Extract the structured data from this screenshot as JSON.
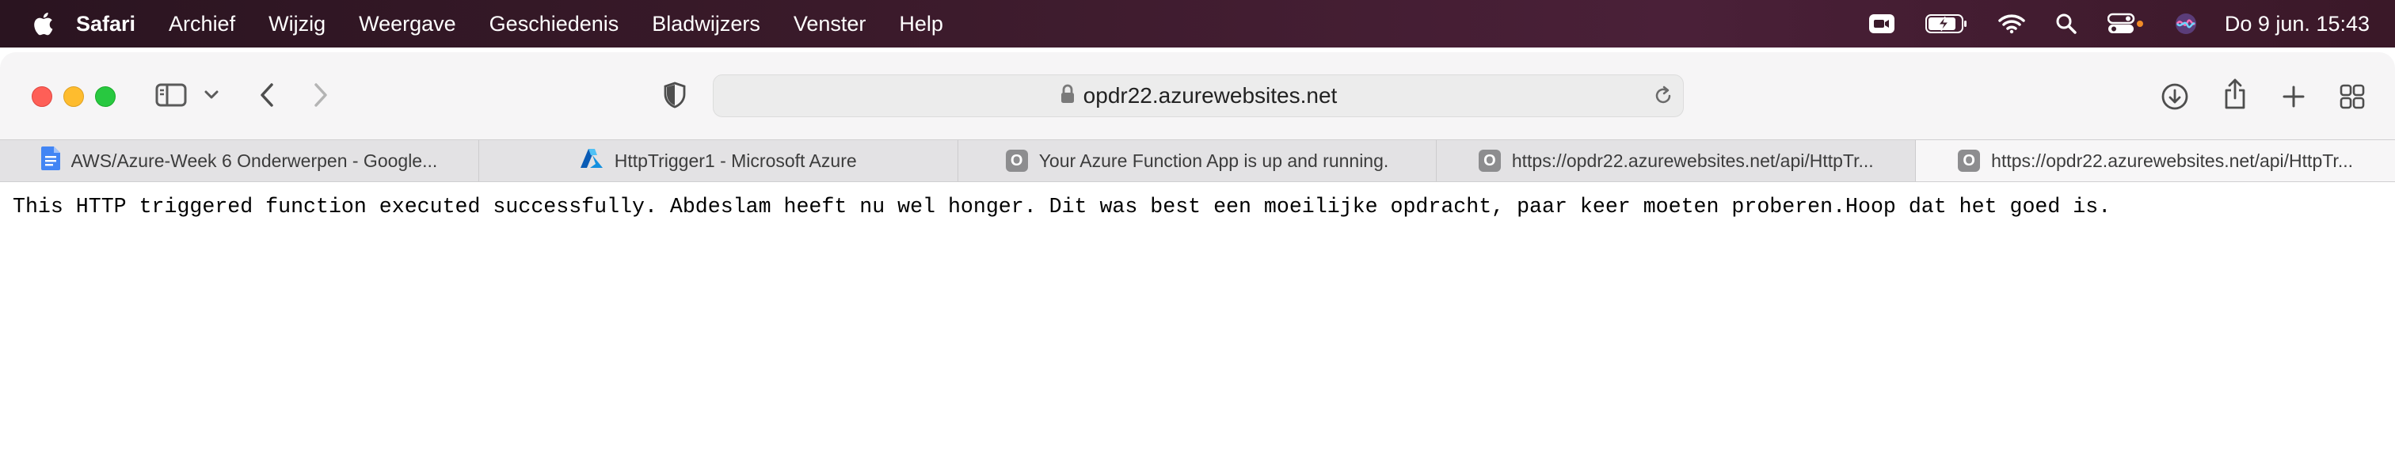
{
  "menubar": {
    "app_name": "Safari",
    "items": [
      "Archief",
      "Wijzig",
      "Weergave",
      "Geschiedenis",
      "Bladwijzers",
      "Venster",
      "Help"
    ],
    "clock": "Do 9 jun.  15:43",
    "status_icons": [
      "facetime-icon",
      "battery-icon",
      "wifi-icon",
      "search-icon",
      "control-center-icon",
      "siri-icon"
    ]
  },
  "toolbar": {
    "url": "opdr22.azurewebsites.net"
  },
  "tabs": [
    {
      "title": "AWS/Azure-Week 6 Onderwerpen - Google...",
      "favicon": "google-docs-icon",
      "active": false
    },
    {
      "title": "HttpTrigger1 - Microsoft Azure",
      "favicon": "azure-icon",
      "active": false
    },
    {
      "title": "Your Azure Function App is up and running.",
      "favicon": "generic-o-icon",
      "active": false
    },
    {
      "title": "https://opdr22.azurewebsites.net/api/HttpTr...",
      "favicon": "generic-o-icon",
      "active": false
    },
    {
      "title": "https://opdr22.azurewebsites.net/api/HttpTr...",
      "favicon": "generic-o-icon",
      "active": true
    }
  ],
  "favicon_letter": "O",
  "page": {
    "body_text": "This HTTP triggered function executed successfully. Abdeslam heeft nu wel honger. Dit was best een moeilijke opdracht, paar keer moeten proberen.Hoop dat het goed is."
  },
  "colors": {
    "close": "#fe5f57",
    "minimize": "#febc2e",
    "zoom": "#28c840",
    "docs_blue": "#4285f4",
    "azure_blue": "#0078d4"
  }
}
